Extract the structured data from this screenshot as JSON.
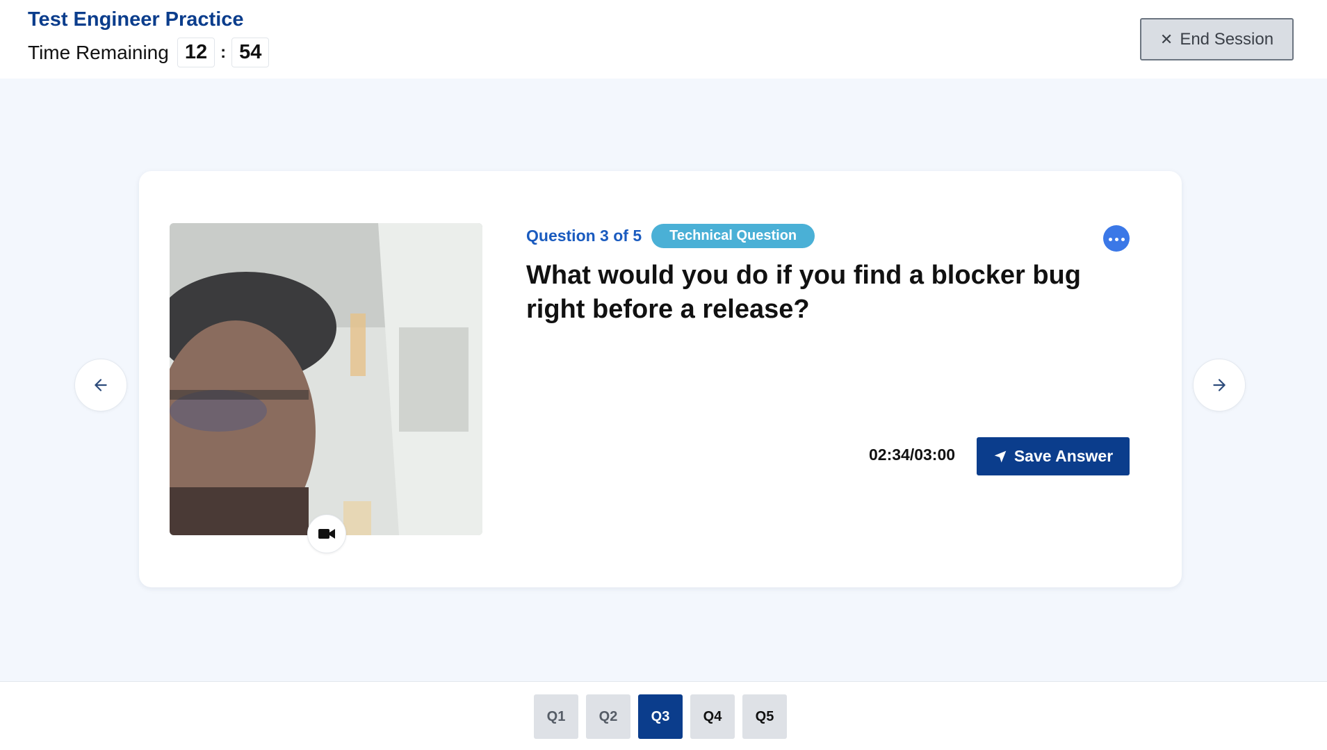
{
  "header": {
    "title": "Test Engineer Practice",
    "timer_label": "Time Remaining",
    "minutes": "12",
    "separator": ":",
    "seconds": "54",
    "end_session_label": "End Session"
  },
  "question": {
    "counter": "Question 3 of 5",
    "category": "Technical Question",
    "text": "What would you do if you find a blocker bug right before a release?",
    "answer_timer": "02:34/03:00",
    "save_label": "Save Answer"
  },
  "pager": {
    "items": [
      {
        "label": "Q1",
        "state": "visited"
      },
      {
        "label": "Q2",
        "state": "visited"
      },
      {
        "label": "Q3",
        "state": "active"
      },
      {
        "label": "Q4",
        "state": "pending"
      },
      {
        "label": "Q5",
        "state": "pending"
      }
    ]
  },
  "colors": {
    "brand": "#0b3d8c",
    "accent_blue": "#1a5bbf",
    "badge": "#4ab0d6",
    "stage_bg": "#f3f7fd"
  },
  "icons": {
    "end_session": "close-icon",
    "prev": "arrow-left-icon",
    "next": "arrow-right-icon",
    "camera": "video-camera-icon",
    "more": "more-horizontal-icon",
    "save": "send-icon"
  }
}
